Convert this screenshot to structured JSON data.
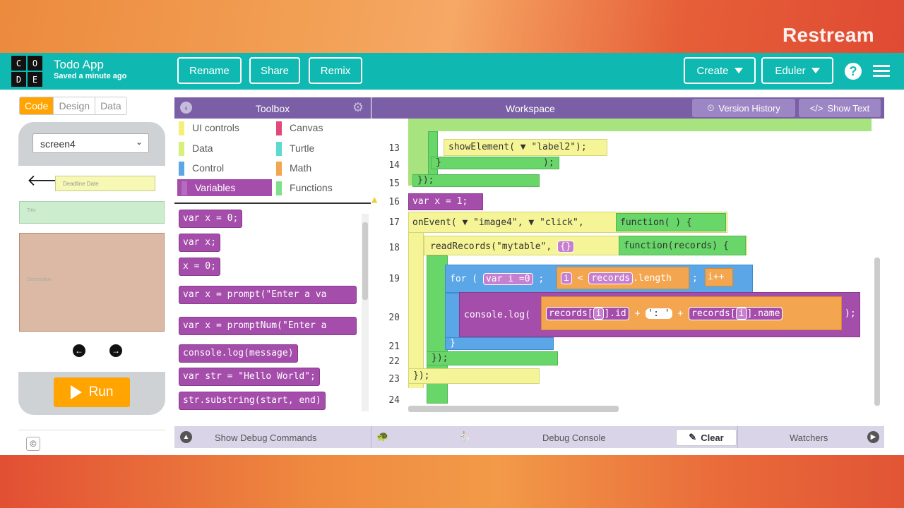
{
  "overlay": {
    "restream_label": "Restream"
  },
  "header": {
    "logo_letters": [
      "C",
      "O",
      "D",
      "E"
    ],
    "app_title": "Todo App",
    "saved_status": "Saved a minute ago",
    "buttons": {
      "rename": "Rename",
      "share": "Share",
      "remix": "Remix",
      "create": "Create",
      "user": "Eduler"
    },
    "help_label": "?"
  },
  "modes": {
    "code": "Code",
    "design": "Design",
    "data": "Data"
  },
  "phone": {
    "screen_select": "screen4",
    "deadline_placeholder": "Deadline Date",
    "title_placeholder": "Title",
    "description_placeholder": "Description",
    "run_label": "Run",
    "copyright": "©"
  },
  "toolbox": {
    "title": "Toolbox",
    "categories": [
      {
        "label": "UI controls",
        "color": "#f4f07a"
      },
      {
        "label": "Canvas",
        "color": "#e0497a"
      },
      {
        "label": "Data",
        "color": "#d6f07a"
      },
      {
        "label": "Turtle",
        "color": "#5ed9d1"
      },
      {
        "label": "Control",
        "color": "#5aa6e6"
      },
      {
        "label": "Math",
        "color": "#f3a64f"
      },
      {
        "label": "Variables",
        "color": "#a44daa"
      },
      {
        "label": "Functions",
        "color": "#7ee08a"
      }
    ],
    "blocks": [
      "var x = 0;",
      "var x;",
      "x = 0;",
      "var x = prompt(\"Enter a va",
      "var x = promptNum(\"Enter a",
      "console.log(message)",
      "var str = \"Hello World\";",
      "str.substring(start, end)"
    ]
  },
  "workspace": {
    "title": "Workspace",
    "version_history": "Version History",
    "show_text": "Show Text",
    "line_numbers": [
      "13",
      "14",
      "15",
      "16",
      "17",
      "18",
      "19",
      "20",
      "21",
      "22",
      "23",
      "24"
    ],
    "code": {
      "line13": "showElement(",
      "line13_arg": "\"label2\");",
      "line15": "});",
      "line16": "var x = 1;",
      "line17_a": "onEvent(",
      "line17_b": "\"image4\",",
      "line17_c": "\"click\",",
      "line17_fn": "function( ) {",
      "line18_a": "readRecords(\"mytable\",",
      "line18_b": "{}",
      "line18_fn": "function(records) {",
      "line19_for": "for (",
      "line19_var": "var i =0",
      "line19_cond_i": "i",
      "line19_cond_op": "<",
      "line19_cond_rec": "records",
      "line19_cond_len": ".length",
      "line19_inc": "i++",
      "line20_log": "console.log(",
      "line20_rec1": "records",
      "line20_i1": "i",
      "line20_id": ".id",
      "line20_plus": "+",
      "line20_sep": "': '",
      "line20_rec2": "records",
      "line20_i2": "i",
      "line20_name": ".name",
      "line20_end": ");",
      "line21": "}",
      "line22": "});",
      "line23": "});"
    }
  },
  "debug": {
    "show_debug": "Show Debug Commands",
    "debug_console": "Debug Console",
    "clear": "Clear",
    "watchers": "Watchers"
  }
}
